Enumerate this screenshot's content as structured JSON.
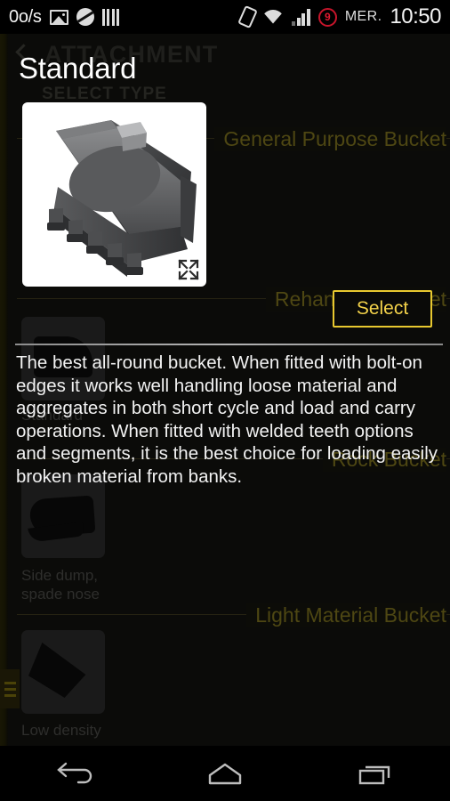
{
  "statusbar": {
    "net_speed": "0o/s",
    "gallery_icon": "gallery-icon",
    "circle_icon": "circle-slash-icon",
    "bars_icon": "barcode-icon",
    "vibrate_icon": "vibrate-icon",
    "wifi_icon": "wifi-icon",
    "signal_icon": "cellular-signal-icon",
    "alarm_count": "9",
    "day": "MER.",
    "time": "10:50"
  },
  "background_page": {
    "back_icon": "back-chevron-icon",
    "app_title": "ATTACHMENT",
    "subhead": "SELECT TYPE",
    "groups": [
      {
        "title": "General Purpose Bucket",
        "items": []
      },
      {
        "title": "Rehandling Bucket",
        "items": [
          {
            "label": "Standard",
            "thumb": "bucket-standard-thumb"
          }
        ]
      },
      {
        "title": "Rock Bucket",
        "items": [
          {
            "label": "Side dump,\nspade nose",
            "thumb": "bucket-side-dump-thumb"
          }
        ]
      },
      {
        "title": "Light Material Bucket",
        "items": [
          {
            "label": "Low density",
            "thumb": "bucket-low-density-thumb"
          }
        ]
      }
    ],
    "side_handle": "hamburger-menu-handle"
  },
  "overlay": {
    "title": "Standard",
    "image_alt": "general-purpose-bucket-render",
    "expand_icon": "expand-fullscreen-icon",
    "select_label": "Select",
    "description": "The best all-round bucket. When fitted with bolt-on edges it works well handling loose material and aggregates in both short cycle and load and carry operations. When fitted with welded teeth options and segments, it is the best choice for loading easily broken material from banks."
  },
  "navbar": {
    "back": "back-nav-icon",
    "home": "home-nav-icon",
    "recents": "recents-nav-icon"
  },
  "colors": {
    "accent": "#e8c82f",
    "accent_text": "#f3d24a",
    "background": "#0b0b09",
    "dim_group_title": "#4e4713",
    "alarm_red": "#e0192f"
  }
}
